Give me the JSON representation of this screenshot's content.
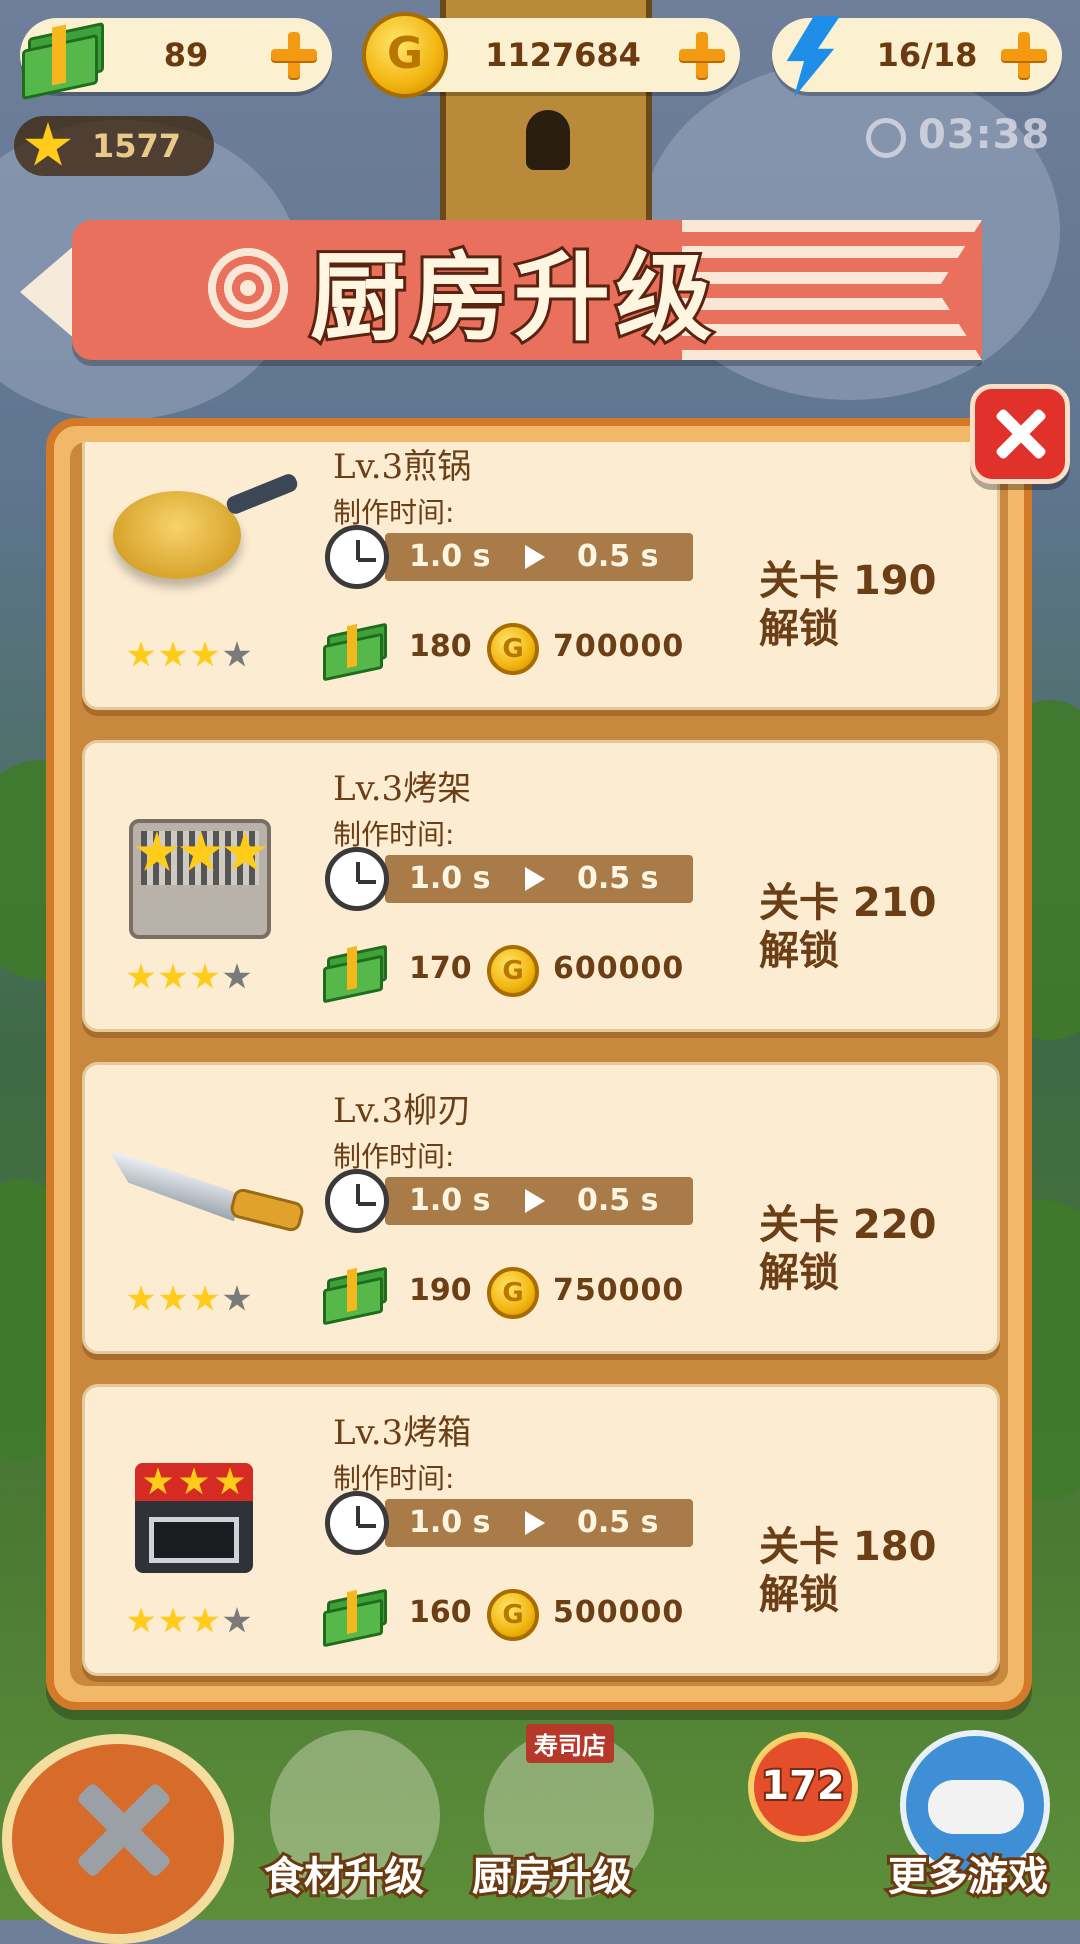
{
  "resources": {
    "cash": {
      "value": "89",
      "icon": "cash-icon",
      "add_icon": "plus-icon"
    },
    "coins": {
      "value": "1127684",
      "icon": "gold-coin-icon",
      "coin_letter": "G",
      "add_icon": "plus-icon"
    },
    "energy": {
      "value": "16/18",
      "icon": "lightning-icon",
      "add_icon": "plus-icon"
    }
  },
  "stars_total": {
    "value": "1577",
    "icon": "star-icon"
  },
  "timer": {
    "value": "03:38",
    "icon": "clock-icon"
  },
  "banner": {
    "title": "厨房升级"
  },
  "items": [
    {
      "level_title": "Lv.3煎锅",
      "time_label": "制作时间:",
      "time_from": "1.0 s",
      "time_to": "0.5 s",
      "stars_filled": 3,
      "stars_total": 4,
      "cash_cost": "180",
      "coin_cost": "700000",
      "unlock_line1": "关卡 190",
      "unlock_line2": "解锁",
      "image": "frying-pan"
    },
    {
      "level_title": "Lv.3烤架",
      "time_label": "制作时间:",
      "time_from": "1.0 s",
      "time_to": "0.5 s",
      "stars_filled": 3,
      "stars_total": 4,
      "cash_cost": "170",
      "coin_cost": "600000",
      "unlock_line1": "关卡 210",
      "unlock_line2": "解锁",
      "image": "grill"
    },
    {
      "level_title": "Lv.3柳刃",
      "time_label": "制作时间:",
      "time_from": "1.0 s",
      "time_to": "0.5 s",
      "stars_filled": 3,
      "stars_total": 4,
      "cash_cost": "190",
      "coin_cost": "750000",
      "unlock_line1": "关卡 220",
      "unlock_line2": "解锁",
      "image": "knife"
    },
    {
      "level_title": "Lv.3烤箱",
      "time_label": "制作时间:",
      "time_from": "1.0 s",
      "time_to": "0.5 s",
      "stars_filled": 3,
      "stars_total": 4,
      "cash_cost": "160",
      "coin_cost": "500000",
      "unlock_line1": "关卡 180",
      "unlock_line2": "解锁",
      "image": "oven"
    }
  ],
  "close_icon": "close-icon",
  "bottom_nav": {
    "back_icon": "close-x-icon",
    "ingredient_upgrade": "食材升级",
    "kitchen_upgrade": "厨房升级",
    "shop_sign": "寿司店",
    "current_level": "172",
    "more_games": "更多游戏"
  },
  "colors": {
    "accent": "#f39a12",
    "panel": "#f2b869",
    "card": "#fbecd2",
    "close": "#e0312b",
    "text": "#6b3e16"
  }
}
